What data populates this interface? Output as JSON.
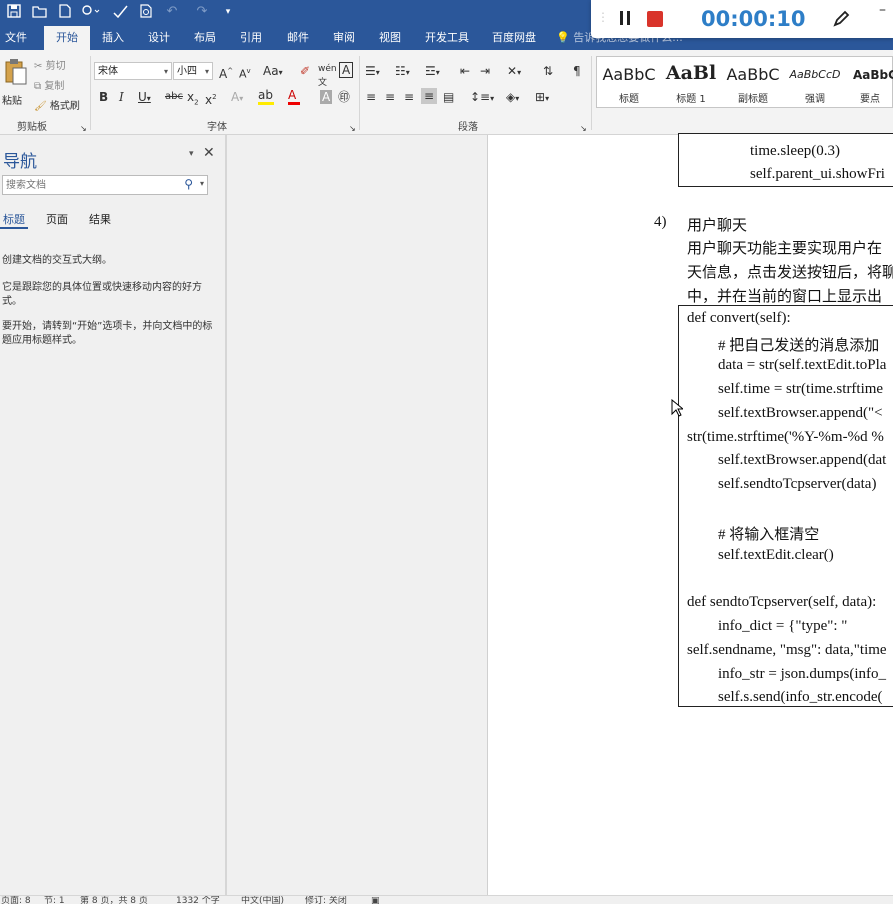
{
  "quick_access": {
    "icons": [
      "save-icon",
      "open-icon",
      "new-document-icon",
      "touch-mode-icon",
      "spelling-icon",
      "print-preview-icon",
      "undo-icon",
      "redo-icon",
      "customize-icon"
    ]
  },
  "tabs": [
    {
      "label": "文件",
      "active": false
    },
    {
      "label": "开始",
      "active": true
    },
    {
      "label": "插入",
      "active": false
    },
    {
      "label": "设计",
      "active": false
    },
    {
      "label": "布局",
      "active": false
    },
    {
      "label": "引用",
      "active": false
    },
    {
      "label": "邮件",
      "active": false
    },
    {
      "label": "审阅",
      "active": false
    },
    {
      "label": "视图",
      "active": false
    },
    {
      "label": "开发工具",
      "active": false
    },
    {
      "label": "百度网盘",
      "active": false
    }
  ],
  "tell_me": {
    "placeholder": "告诉我您想要做什么..."
  },
  "recorder": {
    "timer": "00:00:10"
  },
  "clipboard": {
    "paste": "粘贴",
    "cut": "剪切",
    "copy": "复制",
    "format_painter": "格式刷",
    "group_label": "剪贴板"
  },
  "font": {
    "font_name": "宋体",
    "font_size": "小四",
    "change_case": "Aa",
    "group_label": "字体"
  },
  "paragraph": {
    "group_label": "段落"
  },
  "styles": [
    {
      "preview": "AaBbC",
      "name": "标题"
    },
    {
      "preview": "AaBl",
      "name": "标题 1"
    },
    {
      "preview": "AaBbC",
      "name": "副标题"
    },
    {
      "preview": "AaBbCcD",
      "name": "强调"
    },
    {
      "preview": "AaBbC",
      "name": "要点"
    }
  ],
  "nav": {
    "title": "导航",
    "search_placeholder": "搜索文档",
    "tabs": [
      "标题",
      "页面",
      "结果"
    ],
    "paragraphs": [
      "创建文档的交互式大纲。",
      "它是跟踪您的具体位置或快速移动内容的好方式。",
      "要开始，请转到“开始”选项卡，并向文档中的标题应用标题样式。"
    ]
  },
  "document": {
    "top_code": [
      "time.sleep(0.3)",
      "self.parent_ui.showFri"
    ],
    "section_number": "4)",
    "section_title": "用户聊天",
    "body_lines": [
      "用户聊天功能主要实现用户在",
      "天信息，点击发送按钮后，将聊",
      "中，并在当前的窗口上显示出"
    ],
    "code": [
      {
        "text": "def convert(self):",
        "indent": 0
      },
      {
        "text": "# 把自己发送的消息添加",
        "indent": 1
      },
      {
        "text": "data = str(self.textEdit.toPla",
        "indent": 1
      },
      {
        "text": "self.time = str(time.strftime",
        "indent": 1
      },
      {
        "text": "self.textBrowser.append(\"<",
        "indent": 1
      },
      {
        "text": "str(time.strftime('%Y-%m-%d %",
        "indent": 0
      },
      {
        "text": "self.textBrowser.append(dat",
        "indent": 1
      },
      {
        "text": "self.sendtoTcpserver(data)",
        "indent": 1
      },
      {
        "text": "",
        "indent": 0
      },
      {
        "text": "# 将输入框清空",
        "indent": 1
      },
      {
        "text": "self.textEdit.clear()",
        "indent": 1
      },
      {
        "text": "",
        "indent": 0
      },
      {
        "text": "def sendtoTcpserver(self, data):",
        "indent": 0
      },
      {
        "text": "info_dict   =   {\"type\":   \"",
        "indent": 1
      },
      {
        "text": "self.sendname, \"msg\": data,\"time",
        "indent": 0
      },
      {
        "text": "info_str = json.dumps(info_",
        "indent": 1
      },
      {
        "text": "self.s.send(info_str.encode(",
        "indent": 1
      }
    ]
  },
  "status": {
    "page": "页面: 8",
    "section": "节: 1",
    "page_of": "第 8 页，共 8 页",
    "words": "1332 个字",
    "language": "中文(中国)",
    "track": "修订: 关闭"
  },
  "colors": {
    "accent": "#2b579a",
    "record": "#d9342b",
    "timer": "#2e7ec7"
  }
}
